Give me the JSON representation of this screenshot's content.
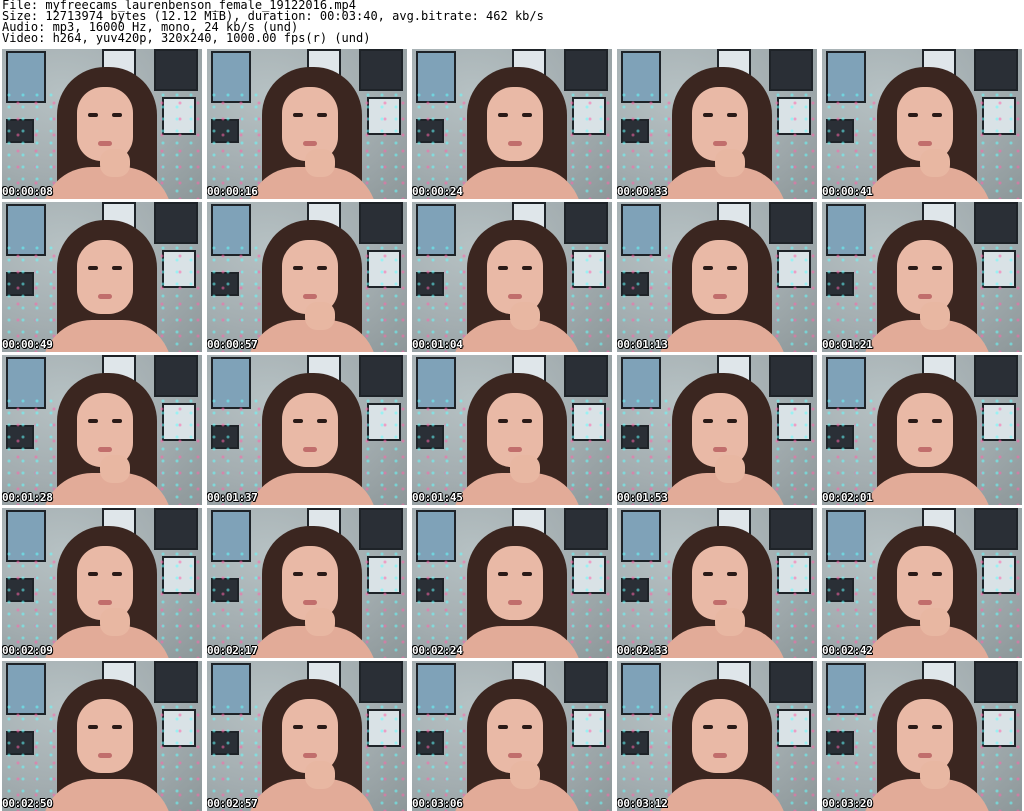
{
  "info": {
    "file": "File: myfreecams_laurenbenson_female_19122016.mp4",
    "size": "Size: 12713974 bytes (12.12 MiB), duration: 00:03:40, avg.bitrate: 462 kb/s",
    "audio": "Audio: mp3, 16000 Hz, mono, 24 kb/s (und)",
    "video": "Video: h264, yuv420p, 320x240, 1000.00 fps(r) (und)"
  },
  "thumbnails": [
    {
      "timestamp": "00:00:08"
    },
    {
      "timestamp": "00:00:16"
    },
    {
      "timestamp": "00:00:24"
    },
    {
      "timestamp": "00:00:33"
    },
    {
      "timestamp": "00:00:41"
    },
    {
      "timestamp": "00:00:49"
    },
    {
      "timestamp": "00:00:57"
    },
    {
      "timestamp": "00:01:04"
    },
    {
      "timestamp": "00:01:13"
    },
    {
      "timestamp": "00:01:21"
    },
    {
      "timestamp": "00:01:28"
    },
    {
      "timestamp": "00:01:37"
    },
    {
      "timestamp": "00:01:45"
    },
    {
      "timestamp": "00:01:53"
    },
    {
      "timestamp": "00:02:01"
    },
    {
      "timestamp": "00:02:09"
    },
    {
      "timestamp": "00:02:17"
    },
    {
      "timestamp": "00:02:24"
    },
    {
      "timestamp": "00:02:33"
    },
    {
      "timestamp": "00:02:42"
    },
    {
      "timestamp": "00:02:50"
    },
    {
      "timestamp": "00:02:57"
    },
    {
      "timestamp": "00:03:06"
    },
    {
      "timestamp": "00:03:12"
    },
    {
      "timestamp": "00:03:20"
    }
  ]
}
